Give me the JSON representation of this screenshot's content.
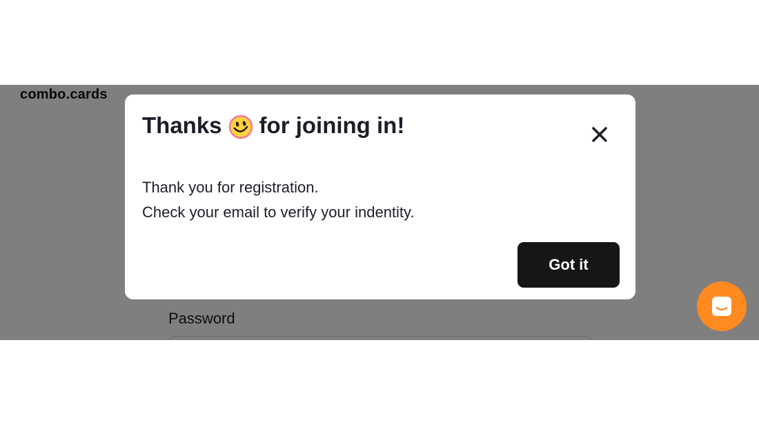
{
  "app": {
    "logo": "combo.cards"
  },
  "form": {
    "password_label": "Password"
  },
  "modal": {
    "title_before": "Thanks",
    "title_after": "for joining in!",
    "emoji_icon": "smiley-face-icon",
    "close_icon": "close-icon",
    "body_line1": "Thank you for registration.",
    "body_line2": "Check your email to verify your indentity.",
    "button_label": "Got it"
  },
  "chat": {
    "icon": "chat-icon",
    "color": "#ff8a1f"
  },
  "colors": {
    "overlay": "#808080",
    "button": "#161616",
    "text": "#1d1d28"
  }
}
